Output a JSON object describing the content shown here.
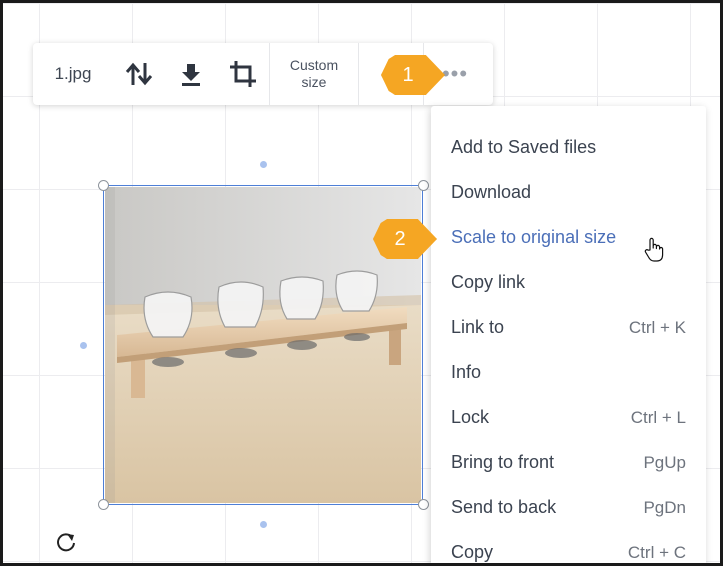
{
  "toolbar": {
    "file_name": "1.jpg",
    "replace_icon": "swap-vertical-icon",
    "download_icon": "download-icon",
    "crop_icon": "crop-icon",
    "custom_size_line1": "Custom",
    "custom_size_line2": "size",
    "more_label": "•••"
  },
  "callouts": {
    "step1": "1",
    "step2": "2"
  },
  "menu": {
    "items": [
      {
        "label": "Add to Saved files",
        "shortcut": ""
      },
      {
        "label": "Download",
        "shortcut": ""
      },
      {
        "label": "Scale to original size",
        "shortcut": ""
      },
      {
        "label": "Copy link",
        "shortcut": ""
      },
      {
        "label": "Link to",
        "shortcut": "Ctrl + K"
      },
      {
        "label": "Info",
        "shortcut": ""
      },
      {
        "label": "Lock",
        "shortcut": "Ctrl + L"
      },
      {
        "label": "Bring to front",
        "shortcut": "PgUp"
      },
      {
        "label": "Send to back",
        "shortcut": "PgDn"
      },
      {
        "label": "Copy",
        "shortcut": "Ctrl + C"
      }
    ]
  },
  "colors": {
    "accent": "#4b6fb8",
    "callout": "#f5a623",
    "selection": "#4e7fd6"
  }
}
